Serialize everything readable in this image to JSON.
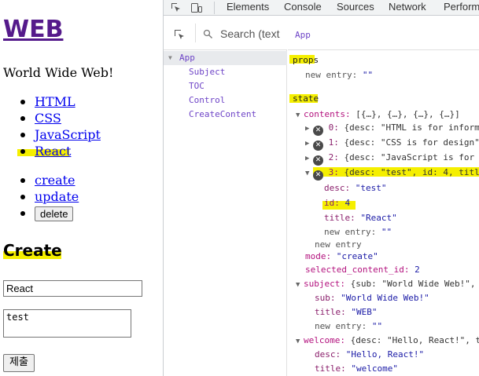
{
  "page": {
    "site_title": "WEB",
    "site_subtitle": "World Wide Web!",
    "toc": [
      "HTML",
      "CSS",
      "JavaScript",
      "React"
    ],
    "controls": {
      "create": "create",
      "update": "update",
      "delete": "delete"
    },
    "form": {
      "heading": "Create",
      "title_value": "React",
      "desc_value": "test",
      "submit_label": "제출"
    }
  },
  "devtools": {
    "tabs": [
      "Elements",
      "Console",
      "Sources",
      "Network",
      "Performa"
    ],
    "components": {
      "search_placeholder": "Search (text",
      "tree": [
        "App",
        "Subject",
        "TOC",
        "Control",
        "CreateContent"
      ]
    },
    "props_panel": {
      "breadcrumb": "App",
      "props_title": "props",
      "new_entry_label": "new entry:",
      "new_entry_value": "\"\"",
      "state_title": "state",
      "contents_key": "contents:",
      "contents_summary": "[{…}, {…}, {…}, {…}]",
      "contents_items": [
        {
          "index": "0:",
          "summary": "{desc: \"HTML is for informat"
        },
        {
          "index": "1:",
          "summary": "{desc: \"CSS is for design\","
        },
        {
          "index": "2:",
          "summary": "{desc: \"JavaScript is for in"
        },
        {
          "index": "3:",
          "summary": "{desc: \"test\", id: 4, title:"
        }
      ],
      "item3": {
        "desc_key": "desc:",
        "desc_val": "\"test\"",
        "id_key": "id:",
        "id_val": "4",
        "title_key": "title:",
        "title_val": "\"React\"",
        "new_entry": "new entry:",
        "new_entry_val": "\"\""
      },
      "contents_new_entry": "new entry",
      "mode_key": "mode:",
      "mode_val": "\"create\"",
      "selected_key": "selected_content_id:",
      "selected_val": "2",
      "subject_key": "subject:",
      "subject_summary": "{sub: \"World Wide Web!\", tit",
      "subject": {
        "sub_key": "sub:",
        "sub_val": "\"World Wide Web!\"",
        "title_key": "title:",
        "title_val": "\"WEB\"",
        "new_entry": "new entry:",
        "new_entry_val": "\"\""
      },
      "welcome_key": "welcome:",
      "welcome_summary": "{desc: \"Hello, React!\", tit",
      "welcome": {
        "desc_key": "desc:",
        "desc_val": "\"Hello, React!\"",
        "title_key": "title:",
        "title_val": "\"welcome\""
      }
    }
  },
  "colors": {
    "highlight": "#f5ef00",
    "link": "#0000ee",
    "visited": "#551a8b",
    "component": "#6e44c7"
  }
}
